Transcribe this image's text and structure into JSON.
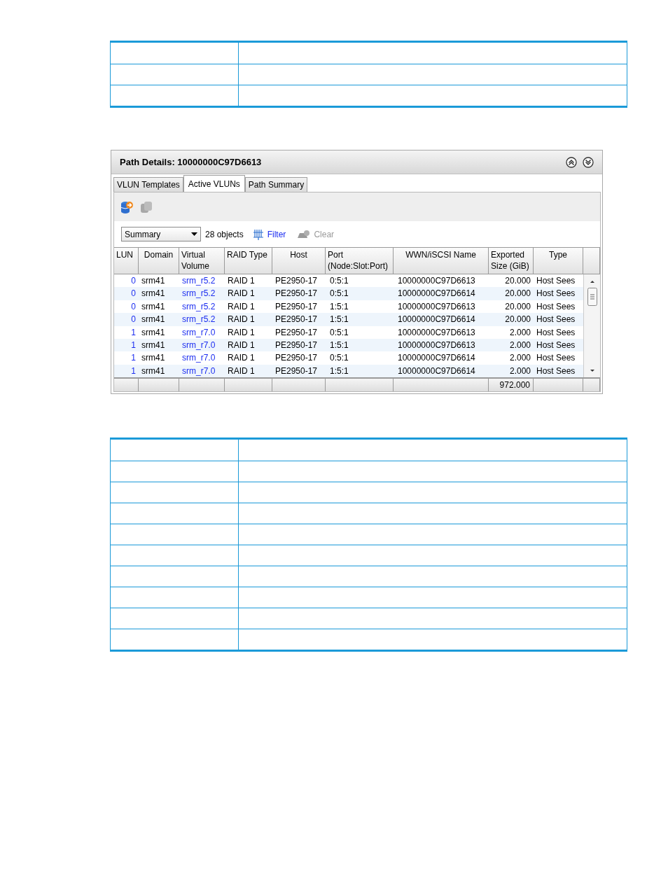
{
  "panel": {
    "title": "Path Details: 10000000C97D6613"
  },
  "tabs": [
    {
      "label": "VLUN Templates",
      "selected": false
    },
    {
      "label": "Active VLUNs",
      "selected": true
    },
    {
      "label": "Path Summary",
      "selected": false
    }
  ],
  "toolbar": {
    "icon_buttons": [
      {
        "disabled": false
      },
      {
        "disabled": true
      }
    ],
    "view_select": "Summary",
    "object_count": "28 objects",
    "filter": {
      "label": "Filter",
      "disabled": false
    },
    "clear": {
      "label": "Clear",
      "disabled": true
    }
  },
  "table": {
    "columns": [
      "LUN",
      "Domain",
      "Virtual Volume",
      "RAID Type",
      "Host",
      "Port (Node:Slot:Port)",
      "WWN/iSCSI Name",
      "Exported Size (GiB)",
      "Type"
    ],
    "rows": [
      [
        "0",
        "srm41",
        "srm_r5.2",
        "RAID 1",
        "PE2950-17",
        "0:5:1",
        "10000000C97D6613",
        "20.000",
        "Host Sees"
      ],
      [
        "0",
        "srm41",
        "srm_r5.2",
        "RAID 1",
        "PE2950-17",
        "0:5:1",
        "10000000C97D6614",
        "20.000",
        "Host Sees"
      ],
      [
        "0",
        "srm41",
        "srm_r5.2",
        "RAID 1",
        "PE2950-17",
        "1:5:1",
        "10000000C97D6613",
        "20.000",
        "Host Sees"
      ],
      [
        "0",
        "srm41",
        "srm_r5.2",
        "RAID 1",
        "PE2950-17",
        "1:5:1",
        "10000000C97D6614",
        "20.000",
        "Host Sees"
      ],
      [
        "1",
        "srm41",
        "srm_r7.0",
        "RAID 1",
        "PE2950-17",
        "0:5:1",
        "10000000C97D6613",
        "2.000",
        "Host Sees"
      ],
      [
        "1",
        "srm41",
        "srm_r7.0",
        "RAID 1",
        "PE2950-17",
        "1:5:1",
        "10000000C97D6613",
        "2.000",
        "Host Sees"
      ],
      [
        "1",
        "srm41",
        "srm_r7.0",
        "RAID 1",
        "PE2950-17",
        "0:5:1",
        "10000000C97D6614",
        "2.000",
        "Host Sees"
      ],
      [
        "1",
        "srm41",
        "srm_r7.0",
        "RAID 1",
        "PE2950-17",
        "1:5:1",
        "10000000C97D6614",
        "2.000",
        "Host Sees"
      ]
    ],
    "footer_total": "972.000"
  }
}
